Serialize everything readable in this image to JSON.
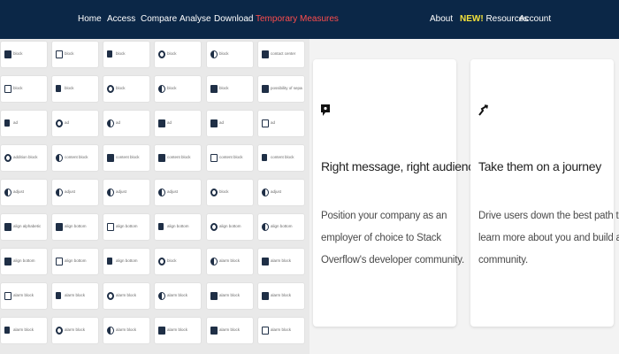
{
  "nav": {
    "left": [
      "Home",
      "Access",
      "Compare",
      "Analyse",
      "Download",
      "Temporary Measures"
    ],
    "about": "About",
    "resources_badge": "NEW!",
    "resources": "Resources",
    "account": "Account"
  },
  "icon_grid": [
    [
      "block",
      "block",
      "block",
      "block",
      "block",
      "contact center"
    ],
    [
      "block",
      "block",
      "block",
      "block",
      "block",
      "possibility of separated"
    ],
    [
      "ad",
      "ad",
      "ad",
      "ad",
      "ad",
      "ad"
    ],
    [
      "addition block",
      "content block",
      "content block",
      "content block",
      "content block",
      "content block"
    ],
    [
      "adjust",
      "adjust",
      "adjust",
      "adjust",
      "block",
      "adjust"
    ],
    [
      "align alphabetic",
      "align bottom",
      "align bottom",
      "align bottom",
      "align bottom",
      "align bottom"
    ],
    [
      "align bottom",
      "align bottom",
      "align bottom",
      "block",
      "alarm block",
      "alarm block"
    ],
    [
      "alarm block",
      "alarm block",
      "alarm block",
      "alarm block",
      "alarm block",
      "alarm block"
    ],
    [
      "alarm block",
      "alarm block",
      "alarm block",
      "alarm block",
      "alarm block",
      "alarm block"
    ]
  ],
  "cards": [
    {
      "title": "Right message, right audience",
      "body": "Position your company as an employer of choice to Stack Overflow's developer community.",
      "icon": "chat-bubble-icon"
    },
    {
      "title": "Take them on a journey",
      "body": "Drive users down the best path to learn more about you and build a community.",
      "icon": "path-arrow-icon"
    }
  ],
  "colors": {
    "nav_bg": "#0b2747",
    "nav_alert": "#ff4d4d",
    "new_badge": "#f2e13b",
    "icon_dark": "#1f2f46"
  }
}
